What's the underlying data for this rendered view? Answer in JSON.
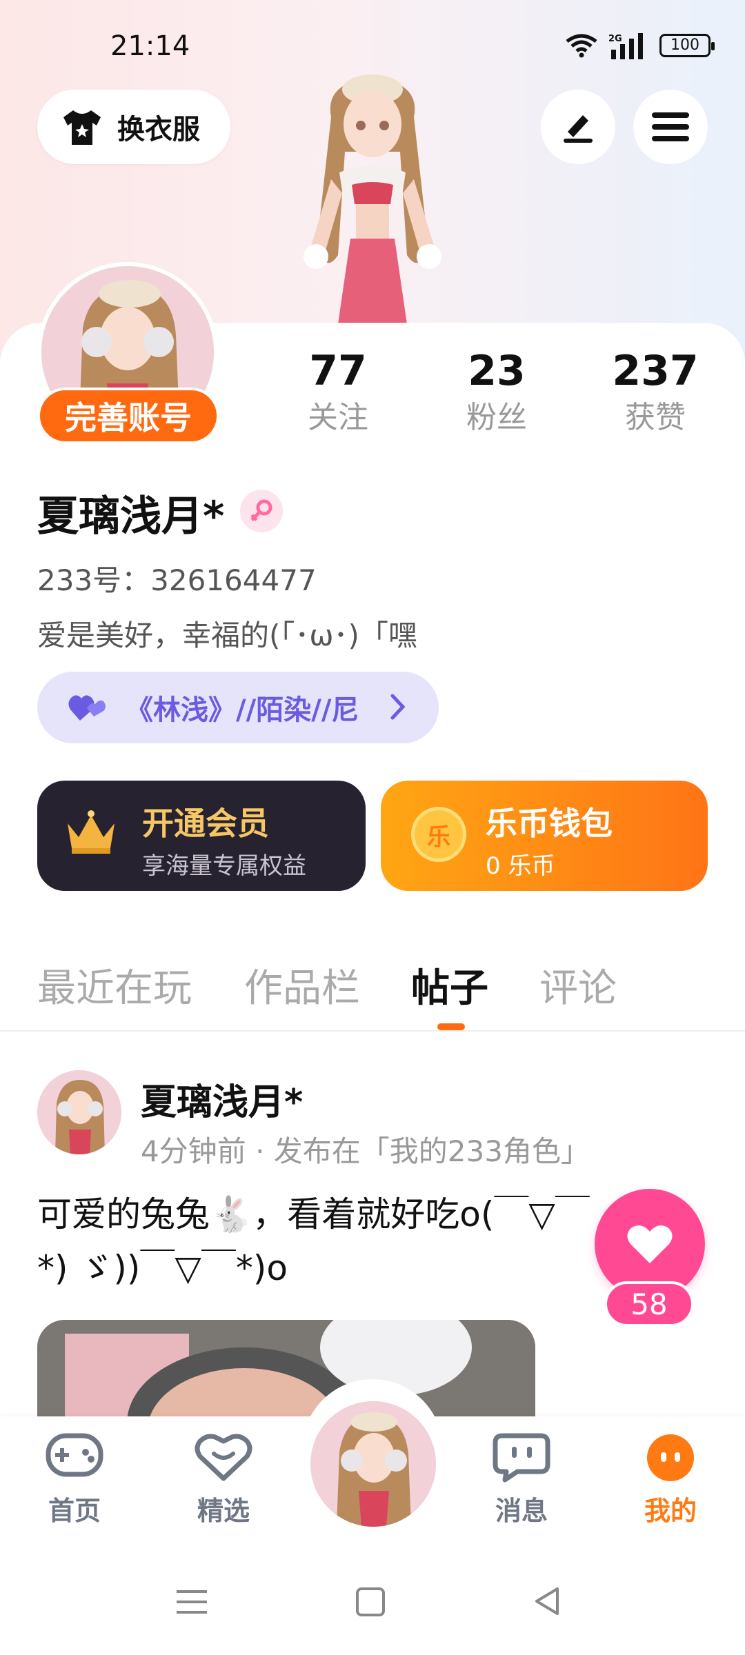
{
  "status_bar": {
    "time": "21:14",
    "battery": "100",
    "network": "2G"
  },
  "header": {
    "dress_button_label": "换衣服"
  },
  "profile": {
    "avatar_badge": "完善账号",
    "name": "夏璃浅月*",
    "uid": "233号：326164477",
    "bio": "爱是美好，幸福的(「･ω･)「嘿",
    "tag": "《林浅》//陌染//尼",
    "stats": [
      {
        "value": "77",
        "label": "关注"
      },
      {
        "value": "23",
        "label": "粉丝"
      },
      {
        "value": "237",
        "label": "获赞"
      }
    ]
  },
  "promo_cards": {
    "vip": {
      "title": "开通会员",
      "subtitle": "享海量专属权益"
    },
    "wallet": {
      "title": "乐币钱包",
      "subtitle": "0 乐币",
      "coin_glyph": "乐"
    }
  },
  "tabs": [
    "最近在玩",
    "作品栏",
    "帖子",
    "评论"
  ],
  "active_tab": "帖子",
  "post": {
    "author": "夏璃浅月*",
    "meta": "4分钟前 · 发布在「我的233角色」",
    "text": "可爱的兔兔🐇，看着就好吃o(￣▽￣*) ゞ))￣▽￣*)o",
    "likes": "58"
  },
  "bottom_nav": [
    {
      "label": "首页",
      "icon": "gamepad-icon"
    },
    {
      "label": "精选",
      "icon": "heart-chat-icon"
    },
    {
      "label": "消息",
      "icon": "message-icon"
    },
    {
      "label": "我的",
      "icon": "profile-face-icon"
    }
  ],
  "colors": {
    "accent": "#ff6a10",
    "like": "#ff4a93",
    "tag_text": "#6a5be0"
  }
}
